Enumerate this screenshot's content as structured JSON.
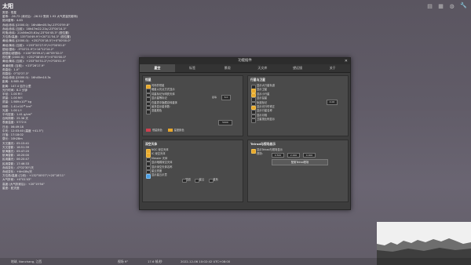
{
  "object": {
    "title": "太阳",
    "info_lines": [
      "类型：恒星",
      "星等：-26.72 (消光后：-26.52 受到 1.93 大气质量的影响)",
      "绝对星等：4.83",
      "赤经/赤纬 (J2000.0)：16h46m05.5s/-23°03'59.8\"",
      "赤经/赤纬 (当前)：16h47m22.21s/-23°04'14.3\"",
      "时角/赤纬：21h56m25.61s/-23°04'45.3\" (视位置)",
      "方位角/高度：135°34'49.9\"/+20°11'54.3\" (视位置)",
      "黄经/黄纬 (J2000.0)：+252°05'18.5\"/+0°00'00.0\"",
      "黄经/黄纬 (当前)：+253°20'27.9\"/+0°00'00.0\"",
      "银经/银纬：-5°02'21.9\"/+14°12'14.2\"",
      "超银经/超银纬：+100°36'09.4\"/-40°09'32.0\"",
      "视位置 (2000.0)：+252°08'49.9\"/+0°00'00.0\"",
      "黄经/黄纬 (当前)：+253°54'51.2\"/+0°00'01.9\"",
      "黄道倾角 (当前)：+23°26'17.9\"",
      "角直径：1.0°",
      "视直径：0°32'27.3\"",
      "赤经/赤纬 (J2000.0)：16h45m10.3s",
      "距离：0.985 AU",
      "距离：147.4 百万公里",
      "光行时间：8.2 分钟",
      "半径：1.00 R☉",
      "质量：1.00 M☉",
      "质量：1.989×10³⁰ kg",
      "体积：1.41×10¹⁸ km³",
      "光度：1.00 L☉",
      "平均密度：1.41 g/cm³",
      "自转周期：25.38 天",
      "表面温度：5772 K",
      "日出：06:49:18",
      "中天：12:03:40 (高度 +41.5°)",
      "日落：17:18:02",
      "昼长：10h28m",
      "天文晨光：05:15:41",
      "天文昏影：18:51:39",
      "航海晨光：05:47:20",
      "航海昏影：18:20:00",
      "民用晨光：06:20:47",
      "民用昏影：17:46:33",
      "赤纬变化：-0°02'30\"/天",
      "赤经变化：+4m18s/天",
      "方位角/高度 (几何)：+132°00'07\"/+20°18'11\"",
      "大气折射：+0°01'43\"",
      "高度 (大气折射后)：+20°19'54\"",
      "星座：蛇夫座"
    ]
  },
  "top_icons": [
    "trash-icon",
    "grid-icon",
    "globe-icon",
    "wrench-icon"
  ],
  "status": {
    "location": "地球, Nanchang, 江西",
    "fov": "视场 9°",
    "fps": "17.6 帧/秒",
    "datetime": "2022-12-06 10:02:42 UTC+08:00"
  },
  "dialog": {
    "title": "功能插件",
    "close": "✕",
    "tabs": [
      "星空",
      "标签",
      "景观",
      "天文库",
      "望远镜",
      "关于"
    ],
    "panes": {
      "stars": {
        "title": "恒星",
        "rows": [
          {
            "label": "闪烁的恒星",
            "checked": true
          },
          {
            "label": "暗星以光点方式显示",
            "checked": false
          },
          {
            "label": "将星标记为明亮天体",
            "checked": false
          },
          {
            "label": "显示星等标记",
            "checked": false
          },
          {
            "label": "在星表中隐藏自转星体",
            "checked": false
          },
          {
            "label": "最多显示星体数：",
            "checked": false
          },
          {
            "label": "变星颜色",
            "checked": false
          }
        ],
        "magnitude_label": "星等",
        "magnitude_value": "6.0",
        "count_value": "5000",
        "color_a": "恒星颜色",
        "color_b": "星座颜色"
      },
      "planets": {
        "title": "行星与卫星",
        "rows": [
          {
            "label": "显示大行星轨道",
            "checked": false
          },
          {
            "label": "显示卫星",
            "checked": true
          },
          {
            "label": "显示小行星",
            "checked": true
          },
          {
            "label": "显示彗星",
            "checked": false
          },
          {
            "label": "轨道标记",
            "checked": false
          },
          {
            "label": "显示光行时修正",
            "checked": true
          },
          {
            "label": "显示行星名称",
            "checked": false
          },
          {
            "label": "显示月相",
            "checked": false
          },
          {
            "label": "卫星按比例显示",
            "checked": false
          }
        ],
        "scale_value": "4.00"
      },
      "sky": {
        "title": "深空天体",
        "rows": [
          {
            "label": "NGC 深空天体",
            "checked": true
          },
          {
            "label": "IC 深空天体",
            "checked": true
          },
          {
            "label": "Messier 天体",
            "checked": false
          },
          {
            "label": "显示暗弱深空天体",
            "checked": false
          },
          {
            "label": "显示深空天体名称",
            "checked": false
          },
          {
            "label": "星云亮度",
            "checked": false
          }
        ],
        "visible_row": "显示星云示意",
        "cb_a": "星团",
        "cb_b": "星云",
        "cb_c": "星系"
      },
      "satellites": {
        "title": "Telrad与视场显示",
        "rows": [
          {
            "label": "显示Telrad与视场显示",
            "checked": true
          }
        ],
        "field_label": "视场：",
        "field_values": [
          "0.500",
          "2.000",
          "4.000"
        ],
        "button": "配置Telrad视场"
      }
    }
  }
}
